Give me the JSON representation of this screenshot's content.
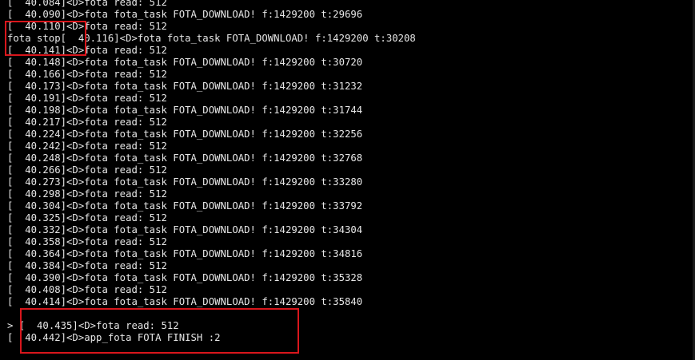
{
  "terminal": {
    "lines": [
      "[  40.084]<D>fota read: 512",
      "[  40.090]<D>fota fota_task FOTA_DOWNLOAD! f:1429200 t:29696",
      "[  40.110]<D>fota read: 512",
      "fota stop[  40.116]<D>fota fota_task FOTA_DOWNLOAD! f:1429200 t:30208",
      "[  40.141]<D>fota read: 512",
      "[  40.148]<D>fota fota_task FOTA_DOWNLOAD! f:1429200 t:30720",
      "[  40.166]<D>fota read: 512",
      "[  40.173]<D>fota fota_task FOTA_DOWNLOAD! f:1429200 t:31232",
      "[  40.191]<D>fota read: 512",
      "[  40.198]<D>fota fota_task FOTA_DOWNLOAD! f:1429200 t:31744",
      "[  40.217]<D>fota read: 512",
      "[  40.224]<D>fota fota_task FOTA_DOWNLOAD! f:1429200 t:32256",
      "[  40.242]<D>fota read: 512",
      "[  40.248]<D>fota fota_task FOTA_DOWNLOAD! f:1429200 t:32768",
      "[  40.266]<D>fota read: 512",
      "[  40.273]<D>fota fota_task FOTA_DOWNLOAD! f:1429200 t:33280",
      "[  40.298]<D>fota read: 512",
      "[  40.304]<D>fota fota_task FOTA_DOWNLOAD! f:1429200 t:33792",
      "[  40.325]<D>fota read: 512",
      "[  40.332]<D>fota fota_task FOTA_DOWNLOAD! f:1429200 t:34304",
      "[  40.358]<D>fota read: 512",
      "[  40.364]<D>fota fota_task FOTA_DOWNLOAD! f:1429200 t:34816",
      "[  40.384]<D>fota read: 512",
      "[  40.390]<D>fota fota_task FOTA_DOWNLOAD! f:1429200 t:35328",
      "[  40.408]<D>fota read: 512",
      "[  40.414]<D>fota fota_task FOTA_DOWNLOAD! f:1429200 t:35840",
      "",
      "> [  40.435]<D>fota read: 512",
      "[  40.442]<D>app_fota FOTA FINISH :2"
    ]
  },
  "colors": {
    "background": "#000000",
    "text": "#e6e6e6",
    "highlight": "#d9161c"
  }
}
